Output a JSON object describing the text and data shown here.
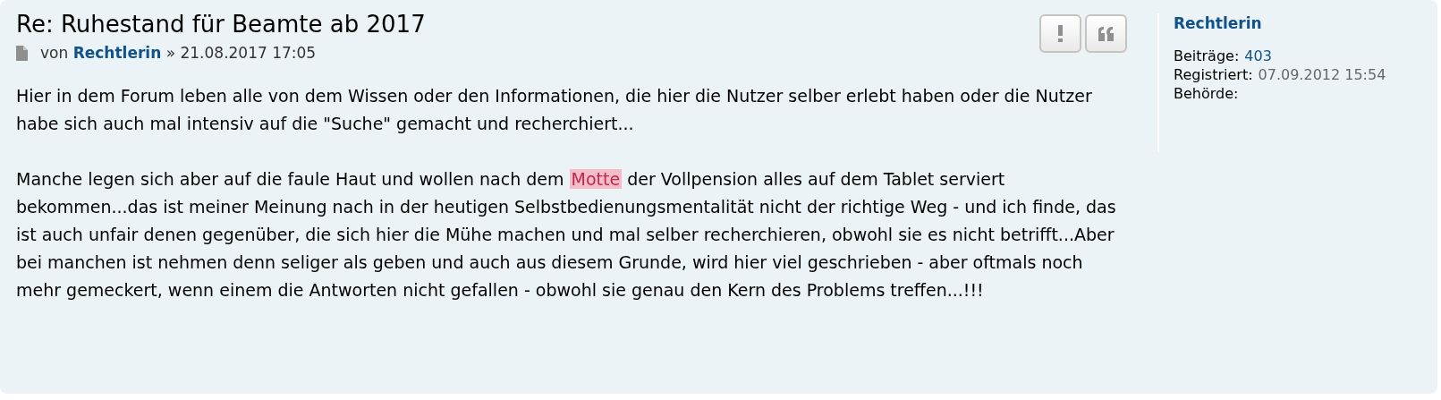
{
  "post": {
    "title": "Re: Ruhestand für Beamte ab 2017",
    "byline": {
      "prefix": "von",
      "author": "Rechtlerin",
      "separator": "»",
      "date": "21.08.2017 17:05"
    },
    "actions": [
      {
        "kind": "report"
      },
      {
        "kind": "quote"
      }
    ],
    "paragraphs": [
      [
        {
          "text": "Hier in dem Forum leben alle von dem Wissen oder den Informationen, die hier die Nutzer selber erlebt haben oder die Nutzer habe sich auch mal intensiv auf die \"Suche\" gemacht und recherchiert...",
          "highlighted": false
        }
      ],
      [
        {
          "text": "Manche legen sich aber auf die faule Haut und wollen nach dem ",
          "highlighted": false
        },
        {
          "text": "Motte",
          "highlighted": true
        },
        {
          "text": " der Vollpension alles auf dem Tablet serviert bekommen...das ist meiner Meinung nach in der heutigen Selbstbedienungsmentalität nicht der richtige Weg - und ich finde, das ist auch unfair denen gegenüber, die sich hier die Mühe machen und mal selber recherchieren, obwohl sie es nicht betrifft...Aber bei manchen ist nehmen denn seliger als geben und auch aus diesem Grunde, wird hier viel geschrieben - aber oftmals noch mehr gemeckert, wenn einem die Antworten nicht gefallen - obwohl sie genau den Kern des Problems treffen...!!!",
          "highlighted": false
        }
      ]
    ]
  },
  "profile": {
    "username": "Rechtlerin",
    "fields": [
      {
        "label": "Beiträge:",
        "value": "403",
        "kind": "link"
      },
      {
        "label": "Registriert:",
        "value": "07.09.2012 15:54",
        "kind": "plain"
      },
      {
        "label": "Behörde:"
      }
    ]
  }
}
